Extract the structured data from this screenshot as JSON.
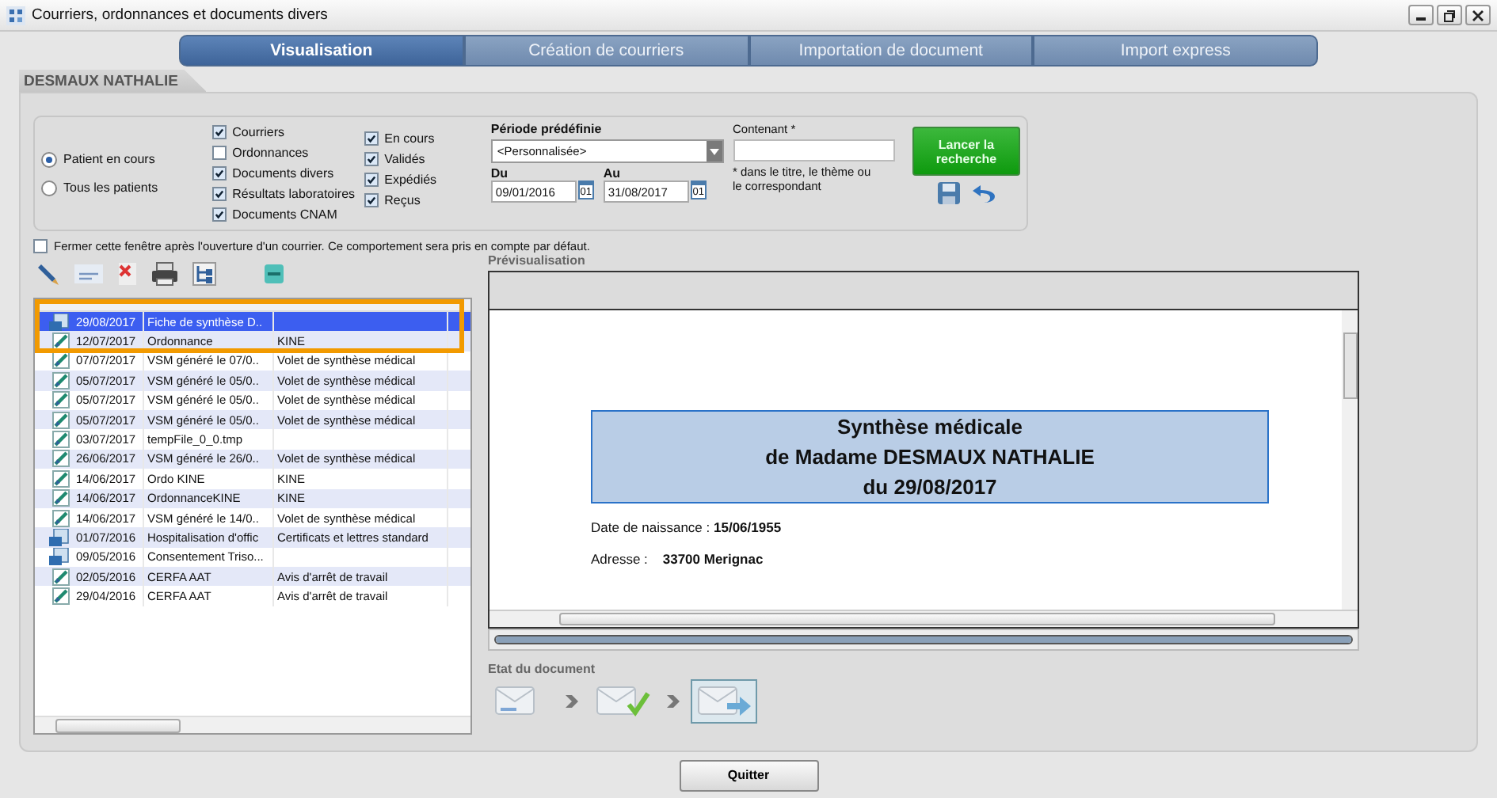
{
  "window": {
    "title": "Courriers, ordonnances et documents divers"
  },
  "tabs": [
    {
      "label": "Visualisation",
      "selected": true
    },
    {
      "label": "Création de courriers",
      "selected": false
    },
    {
      "label": "Importation de document",
      "selected": false
    },
    {
      "label": "Import express",
      "selected": false
    }
  ],
  "patient_name": "DESMAUX NATHALIE",
  "scope": [
    {
      "label": "Patient en cours",
      "selected": true
    },
    {
      "label": "Tous les patients",
      "selected": false
    }
  ],
  "types": [
    {
      "label": "Courriers",
      "checked": true
    },
    {
      "label": "Ordonnances",
      "checked": false
    },
    {
      "label": "Documents divers",
      "checked": true
    },
    {
      "label": "Résultats laboratoires",
      "checked": true
    },
    {
      "label": "Documents CNAM",
      "checked": true
    }
  ],
  "statuses": [
    {
      "label": "En cours",
      "checked": true
    },
    {
      "label": "Validés",
      "checked": true
    },
    {
      "label": "Expédiés",
      "checked": true
    },
    {
      "label": "Reçus",
      "checked": true
    }
  ],
  "period": {
    "label": "Période prédéfinie",
    "value": "<Personnalisée>",
    "from_label": "Du",
    "from": "09/01/2016",
    "to_label": "Au",
    "to": "31/08/2017",
    "from_calendar": "01",
    "to_calendar": "01"
  },
  "contains": {
    "label": "Contenant *",
    "hint": "* dans le titre, le thème ou le correspondant"
  },
  "search_button": "Lancer la recherche",
  "close_option": {
    "label": "Fermer cette fenêtre après l'ouverture d'un courrier. Ce comportement sera pris en compte par défaut.",
    "checked": false
  },
  "rows": [
    {
      "kind": "letter",
      "date": "29/08/2017",
      "title": "Fiche de synthèse D..",
      "theme": "",
      "selected": true
    },
    {
      "kind": "edit",
      "date": "12/07/2017",
      "title": "Ordonnance",
      "theme": "KINE",
      "selected": false
    },
    {
      "kind": "edit",
      "date": "07/07/2017",
      "title": "VSM généré le 07/0..",
      "theme": "Volet de synthèse médical",
      "selected": false
    },
    {
      "kind": "edit",
      "date": "05/07/2017",
      "title": "VSM généré le 05/0..",
      "theme": "Volet de synthèse médical",
      "selected": false
    },
    {
      "kind": "edit",
      "date": "05/07/2017",
      "title": "VSM généré le 05/0..",
      "theme": "Volet de synthèse médical",
      "selected": false
    },
    {
      "kind": "edit",
      "date": "05/07/2017",
      "title": "VSM généré le 05/0..",
      "theme": "Volet de synthèse médical",
      "selected": false
    },
    {
      "kind": "edit",
      "date": "03/07/2017",
      "title": "tempFile_0_0.tmp",
      "theme": "",
      "selected": false
    },
    {
      "kind": "edit",
      "date": "26/06/2017",
      "title": "VSM généré le 26/0..",
      "theme": "Volet de synthèse médical",
      "selected": false
    },
    {
      "kind": "edit",
      "date": "14/06/2017",
      "title": "Ordo KINE",
      "theme": "KINE",
      "selected": false
    },
    {
      "kind": "edit",
      "date": "14/06/2017",
      "title": "OrdonnanceKINE",
      "theme": "KINE",
      "selected": false
    },
    {
      "kind": "edit",
      "date": "14/06/2017",
      "title": "VSM généré le 14/0..",
      "theme": "Volet de synthèse médical",
      "selected": false
    },
    {
      "kind": "letter",
      "date": "01/07/2016",
      "title": "Hospitalisation d'offic",
      "theme": "Certificats et lettres standard",
      "selected": false
    },
    {
      "kind": "letter",
      "date": "09/05/2016",
      "title": "Consentement Triso...",
      "theme": "",
      "selected": false
    },
    {
      "kind": "edit",
      "date": "02/05/2016",
      "title": "CERFA AAT",
      "theme": "Avis d'arrêt de travail",
      "selected": false
    },
    {
      "kind": "edit",
      "date": "29/04/2016",
      "title": "CERFA AAT",
      "theme": "Avis d'arrêt de travail",
      "selected": false
    }
  ],
  "preview": {
    "label": "Prévisualisation",
    "heading": [
      "Synthèse médicale",
      "de Madame DESMAUX NATHALIE",
      "du 29/08/2017"
    ],
    "lines": [
      "Date de naissance : **15/06/1955**",
      "Adresse :    **33700 Merignac**"
    ],
    "level": 1
  },
  "document_state": {
    "label": "Etat du document",
    "steps": [
      {
        "kind": "draft",
        "selected": false
      },
      {
        "kind": "validated",
        "selected": false
      },
      {
        "kind": "sent",
        "selected": true
      }
    ]
  },
  "quit_button": "Quitter"
}
